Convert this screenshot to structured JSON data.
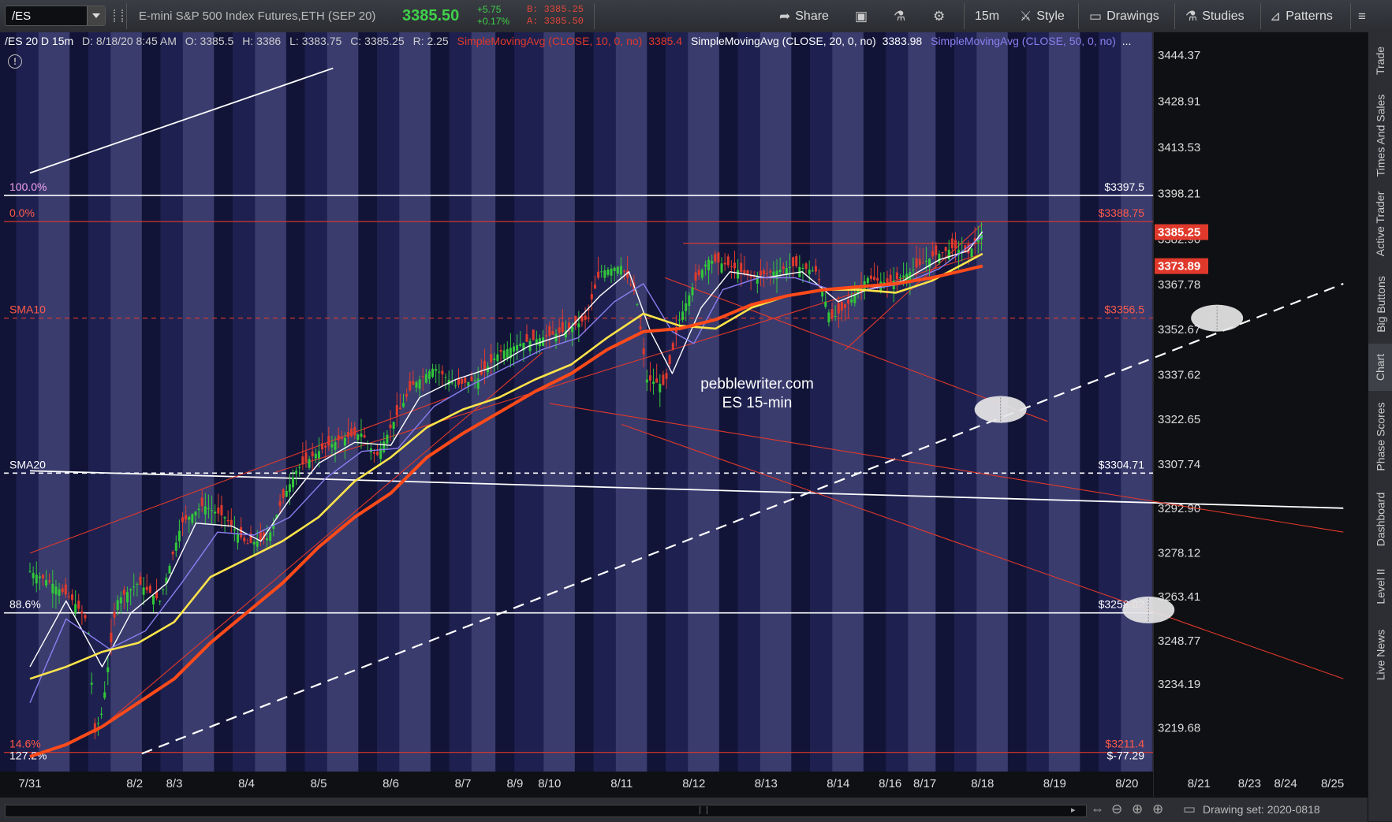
{
  "toolbar": {
    "symbol": "/ES",
    "description": "E-mini S&P 500 Index Futures,ETH (SEP 20)",
    "last": "3385.50",
    "change": "+5.75",
    "change_pct": "+0.17%",
    "bid": "B: 3385.25",
    "ask": "A: 3385.50",
    "share": "Share",
    "timeframe": "15m",
    "style": "Style",
    "drawings": "Drawings",
    "studies": "Studies",
    "patterns": "Patterns"
  },
  "chart_info": {
    "title": "/ES 20 D 15m",
    "date": "D: 8/18/20 8:45 AM",
    "open": "O: 3385.5",
    "high": "H: 3386",
    "low": "L: 3383.75",
    "close": "C: 3385.25",
    "range": "R: 2.25",
    "sma10_label": "SimpleMovingAvg (CLOSE, 10, 0, no)",
    "sma10_value": "3385.4",
    "sma20_label": "SimpleMovingAvg (CLOSE, 20, 0, no)",
    "sma20_value": "3383.98",
    "sma50_label": "SimpleMovingAvg (CLOSE, 50, 0, no)",
    "more": "..."
  },
  "side_tabs": [
    "Trade",
    "Times And Sales",
    "Active Trader",
    "Big Buttons",
    "Chart",
    "Phase Scores",
    "Dashboard",
    "Level II",
    "Live News"
  ],
  "bottom": {
    "drawing_set": "Drawing set: 2020-0818"
  },
  "chart_data": {
    "type": "candlestick-line",
    "symbol": "/ES",
    "interval": "15m",
    "watermark": [
      "pebblewriter.com",
      "ES 15-min"
    ],
    "price_axis_ticks": [
      3444.37,
      3428.91,
      3413.53,
      3398.21,
      3382.9,
      3367.78,
      3352.67,
      3337.62,
      3322.65,
      3307.74,
      3292.9,
      3278.12,
      3263.41,
      3248.77,
      3234.19,
      3219.68
    ],
    "y_range": [
      3205,
      3452
    ],
    "price_badges": [
      {
        "text": "3385.25",
        "price": 3385.25,
        "color": "#e0392b"
      },
      {
        "text": "3373.89",
        "price": 3373.89,
        "color": "#e0392b"
      }
    ],
    "x_labels": [
      {
        "label": "7/31",
        "day": 0
      },
      {
        "label": "8/2",
        "day": 1.45
      },
      {
        "label": "8/3",
        "day": 2
      },
      {
        "label": "8/4",
        "day": 3
      },
      {
        "label": "8/5",
        "day": 4
      },
      {
        "label": "8/6",
        "day": 5
      },
      {
        "label": "8/7",
        "day": 6
      },
      {
        "label": "8/9",
        "day": 6.72
      },
      {
        "label": "8/10",
        "day": 7.2
      },
      {
        "label": "8/11",
        "day": 8.2
      },
      {
        "label": "8/12",
        "day": 9.2
      },
      {
        "label": "8/13",
        "day": 10.2
      },
      {
        "label": "8/14",
        "day": 11.2
      },
      {
        "label": "8/16",
        "day": 11.92
      },
      {
        "label": "8/17",
        "day": 12.4
      },
      {
        "label": "8/18",
        "day": 13.2
      },
      {
        "label": "8/19",
        "day": 14.2
      },
      {
        "label": "8/20",
        "day": 15.2
      },
      {
        "label": "8/21",
        "day": 16.2
      },
      {
        "label": "8/23",
        "day": 16.9
      },
      {
        "label": "8/24",
        "day": 17.4
      },
      {
        "label": "8/25",
        "day": 18.05
      }
    ],
    "horizontal_levels": [
      {
        "left_label": "100.0%",
        "right_label": "$3397.5",
        "price": 3397.5,
        "color": "#ffffff",
        "style": "solid"
      },
      {
        "left_label": "0.0%",
        "right_label": "$3388.75",
        "price": 3388.75,
        "color": "#e0392b",
        "style": "solid"
      },
      {
        "left_label": "SMA10",
        "right_label": "$3356.5",
        "price": 3356.5,
        "color": "#e0392b",
        "style": "dashed"
      },
      {
        "left_label": "SMA20",
        "right_label": "$3304.71",
        "price": 3304.71,
        "color": "#ffffff",
        "style": "dashed"
      },
      {
        "left_label": "88.6%",
        "right_label": "$3258.02",
        "price": 3258.02,
        "color": "#ffffff",
        "style": "solid"
      },
      {
        "left_label": "14.6%",
        "right_label": "$3211.4",
        "price": 3211.4,
        "color": "#e0392b",
        "style": "solid"
      },
      {
        "left_label": "127.2%",
        "right_label": "$-77.29",
        "price": 3207.5,
        "color": "#ffffff",
        "style": "none"
      }
    ],
    "trendlines": [
      {
        "color": "#ffffff",
        "dash": true,
        "points": [
          [
            1.55,
            3211
          ],
          [
            18.2,
            3368
          ]
        ]
      },
      {
        "color": "#ffffff",
        "dash": false,
        "points": [
          [
            0,
            3305.5
          ],
          [
            18.2,
            3293
          ]
        ]
      },
      {
        "color": "#ffffff",
        "dash": false,
        "points": [
          [
            0,
            3405
          ],
          [
            4.2,
            3440
          ]
        ]
      },
      {
        "color": "#e0392b",
        "dash": false,
        "points": [
          [
            7.2,
            3328
          ],
          [
            18.2,
            3285
          ]
        ]
      },
      {
        "color": "#e0392b",
        "dash": false,
        "points": [
          [
            8.2,
            3321
          ],
          [
            18.2,
            3236
          ]
        ]
      },
      {
        "color": "#e0392b",
        "dash": false,
        "points": [
          [
            8.8,
            3370
          ],
          [
            14.1,
            3322
          ]
        ]
      },
      {
        "color": "#e0392b",
        "dash": false,
        "points": [
          [
            0,
            3278
          ],
          [
            5.8,
            3330
          ]
        ]
      },
      {
        "color": "#e0392b",
        "dash": false,
        "points": [
          [
            0.9,
            3218
          ],
          [
            7.1,
            3345
          ]
        ]
      },
      {
        "color": "#e0392b",
        "dash": false,
        "points": [
          [
            3.4,
            3305
          ],
          [
            13.2,
            3378
          ]
        ]
      },
      {
        "color": "#e0392b",
        "dash": false,
        "points": [
          [
            11.3,
            3346
          ],
          [
            13.2,
            3388
          ]
        ]
      },
      {
        "color": "#e0392b",
        "dash": false,
        "points": [
          [
            9.05,
            3381.5
          ],
          [
            13.2,
            3381.5
          ]
        ]
      }
    ],
    "ellipses": [
      {
        "day": 16.45,
        "price": 3356.5
      },
      {
        "day": 13.45,
        "price": 3326
      },
      {
        "day": 15.5,
        "price": 3259
      }
    ],
    "series": [
      {
        "name": "Close",
        "color": "#2bbd3a",
        "points": [
          [
            0,
            3272
          ],
          [
            0.3,
            3268
          ],
          [
            0.6,
            3262
          ],
          [
            0.8,
            3255
          ],
          [
            0.9,
            3218
          ],
          [
            1.0,
            3225
          ],
          [
            1.2,
            3262
          ],
          [
            1.5,
            3268
          ],
          [
            1.8,
            3262
          ],
          [
            2.1,
            3288
          ],
          [
            2.4,
            3294
          ],
          [
            2.7,
            3290
          ],
          [
            3.0,
            3281
          ],
          [
            3.3,
            3283
          ],
          [
            3.5,
            3296
          ],
          [
            3.7,
            3306
          ],
          [
            4.0,
            3312
          ],
          [
            4.3,
            3316
          ],
          [
            4.6,
            3318
          ],
          [
            4.8,
            3310
          ],
          [
            5.0,
            3320
          ],
          [
            5.3,
            3334
          ],
          [
            5.6,
            3340
          ],
          [
            5.9,
            3334
          ],
          [
            6.2,
            3336
          ],
          [
            6.5,
            3345
          ],
          [
            6.8,
            3348
          ],
          [
            7.1,
            3350
          ],
          [
            7.4,
            3352
          ],
          [
            7.7,
            3356
          ],
          [
            7.9,
            3372
          ],
          [
            8.2,
            3374
          ],
          [
            8.4,
            3364
          ],
          [
            8.55,
            3336
          ],
          [
            8.8,
            3334
          ],
          [
            9.0,
            3356
          ],
          [
            9.2,
            3368
          ],
          [
            9.4,
            3376
          ],
          [
            9.7,
            3374
          ],
          [
            10.0,
            3370
          ],
          [
            10.3,
            3372
          ],
          [
            10.6,
            3374
          ],
          [
            10.9,
            3372
          ],
          [
            11.1,
            3356
          ],
          [
            11.3,
            3360
          ],
          [
            11.6,
            3370
          ],
          [
            11.9,
            3368
          ],
          [
            12.2,
            3372
          ],
          [
            12.5,
            3377
          ],
          [
            12.8,
            3380
          ],
          [
            13.0,
            3378
          ],
          [
            13.2,
            3385
          ]
        ]
      },
      {
        "name": "SMA10",
        "color": "#ffffff",
        "points": [
          [
            0,
            3240
          ],
          [
            0.5,
            3262
          ],
          [
            1.0,
            3240
          ],
          [
            1.4,
            3258
          ],
          [
            1.9,
            3268
          ],
          [
            2.3,
            3288
          ],
          [
            2.8,
            3287
          ],
          [
            3.2,
            3282
          ],
          [
            3.6,
            3296
          ],
          [
            4.0,
            3308
          ],
          [
            4.5,
            3315
          ],
          [
            5.0,
            3314
          ],
          [
            5.4,
            3330
          ],
          [
            5.9,
            3336
          ],
          [
            6.4,
            3340
          ],
          [
            6.9,
            3347
          ],
          [
            7.4,
            3351
          ],
          [
            7.9,
            3364
          ],
          [
            8.3,
            3372
          ],
          [
            8.6,
            3352
          ],
          [
            8.9,
            3338
          ],
          [
            9.3,
            3360
          ],
          [
            9.7,
            3372
          ],
          [
            10.2,
            3370
          ],
          [
            10.7,
            3372
          ],
          [
            11.2,
            3362
          ],
          [
            11.6,
            3366
          ],
          [
            12.1,
            3369
          ],
          [
            12.6,
            3376
          ],
          [
            13.0,
            3379
          ],
          [
            13.2,
            3385.4
          ]
        ]
      },
      {
        "name": "SMA20",
        "color": "#8a7ff0",
        "points": [
          [
            0,
            3228
          ],
          [
            0.5,
            3256
          ],
          [
            1.1,
            3246
          ],
          [
            1.6,
            3252
          ],
          [
            2.1,
            3268
          ],
          [
            2.6,
            3285
          ],
          [
            3.1,
            3284
          ],
          [
            3.6,
            3290
          ],
          [
            4.1,
            3303
          ],
          [
            4.6,
            3312
          ],
          [
            5.1,
            3313
          ],
          [
            5.6,
            3327
          ],
          [
            6.1,
            3334
          ],
          [
            6.6,
            3340
          ],
          [
            7.1,
            3346
          ],
          [
            7.6,
            3350
          ],
          [
            8.1,
            3362
          ],
          [
            8.5,
            3368
          ],
          [
            8.9,
            3352
          ],
          [
            9.2,
            3348
          ],
          [
            9.6,
            3366
          ],
          [
            10.1,
            3370
          ],
          [
            10.6,
            3370
          ],
          [
            11.1,
            3366
          ],
          [
            11.6,
            3366
          ],
          [
            12.1,
            3368
          ],
          [
            12.6,
            3373
          ],
          [
            13.2,
            3383.98
          ]
        ]
      },
      {
        "name": "SMA50",
        "color": "#ffe44a",
        "points": [
          [
            0,
            3236
          ],
          [
            0.5,
            3240
          ],
          [
            1.0,
            3245
          ],
          [
            1.5,
            3248
          ],
          [
            2.0,
            3255
          ],
          [
            2.5,
            3270
          ],
          [
            3.0,
            3276
          ],
          [
            3.5,
            3282
          ],
          [
            4.0,
            3290
          ],
          [
            4.5,
            3302
          ],
          [
            5.0,
            3310
          ],
          [
            5.5,
            3320
          ],
          [
            6.0,
            3326
          ],
          [
            6.5,
            3330
          ],
          [
            7.0,
            3336
          ],
          [
            7.5,
            3341
          ],
          [
            8.0,
            3350
          ],
          [
            8.5,
            3358
          ],
          [
            9.0,
            3354
          ],
          [
            9.5,
            3353
          ],
          [
            10.0,
            3360
          ],
          [
            10.5,
            3364
          ],
          [
            11.0,
            3366
          ],
          [
            11.5,
            3366
          ],
          [
            12.0,
            3365
          ],
          [
            12.5,
            3369
          ],
          [
            13.2,
            3378
          ]
        ]
      },
      {
        "name": "SMA200",
        "color": "#ff4a1a",
        "points": [
          [
            0,
            3210
          ],
          [
            0.5,
            3214
          ],
          [
            1.0,
            3220
          ],
          [
            1.5,
            3228
          ],
          [
            2.0,
            3236
          ],
          [
            2.5,
            3248
          ],
          [
            3.0,
            3258
          ],
          [
            3.5,
            3268
          ],
          [
            4.0,
            3280
          ],
          [
            4.5,
            3290
          ],
          [
            5.0,
            3298
          ],
          [
            5.5,
            3310
          ],
          [
            6.0,
            3318
          ],
          [
            6.5,
            3325
          ],
          [
            7.0,
            3332
          ],
          [
            7.5,
            3338
          ],
          [
            8.0,
            3346
          ],
          [
            8.5,
            3352
          ],
          [
            9.0,
            3353
          ],
          [
            9.5,
            3356
          ],
          [
            10.0,
            3361
          ],
          [
            10.5,
            3364
          ],
          [
            11.0,
            3366
          ],
          [
            11.5,
            3367
          ],
          [
            12.0,
            3368
          ],
          [
            12.5,
            3370
          ],
          [
            13.2,
            3373.89
          ]
        ]
      }
    ]
  }
}
